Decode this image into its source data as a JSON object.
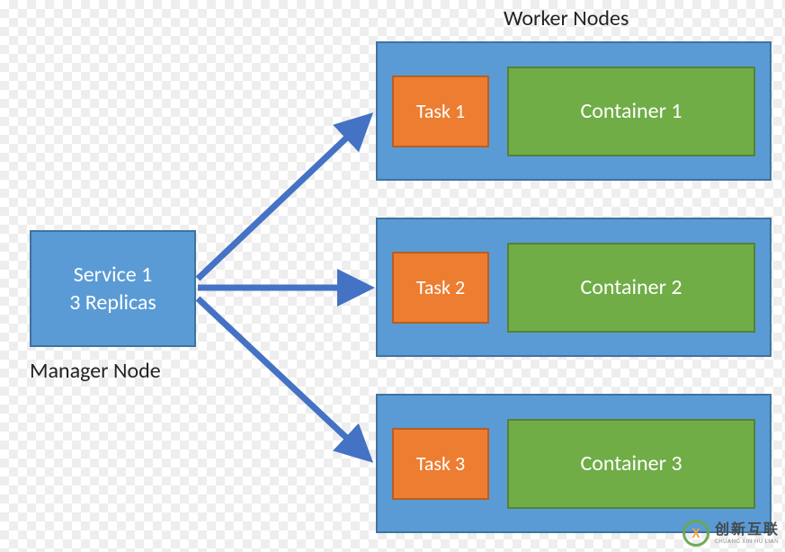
{
  "manager": {
    "title_line1": "Service 1",
    "title_line2": "3 Replicas",
    "label": "Manager Node"
  },
  "workers_label": "Worker Nodes",
  "workers": [
    {
      "task": "Task 1",
      "container": "Container 1"
    },
    {
      "task": "Task 2",
      "container": "Container 2"
    },
    {
      "task": "Task 3",
      "container": "Container 3"
    }
  ],
  "watermark": {
    "letter": "X",
    "cn": "创新互联",
    "py": "CHUANG XIN HU LIAN"
  },
  "colors": {
    "node_fill": "#5a9bd5",
    "node_border": "#3f73a0",
    "task_fill": "#ed7d31",
    "task_border": "#b85e22",
    "container_fill": "#70ad47",
    "container_border": "#548235",
    "arrow": "#4472c4"
  }
}
